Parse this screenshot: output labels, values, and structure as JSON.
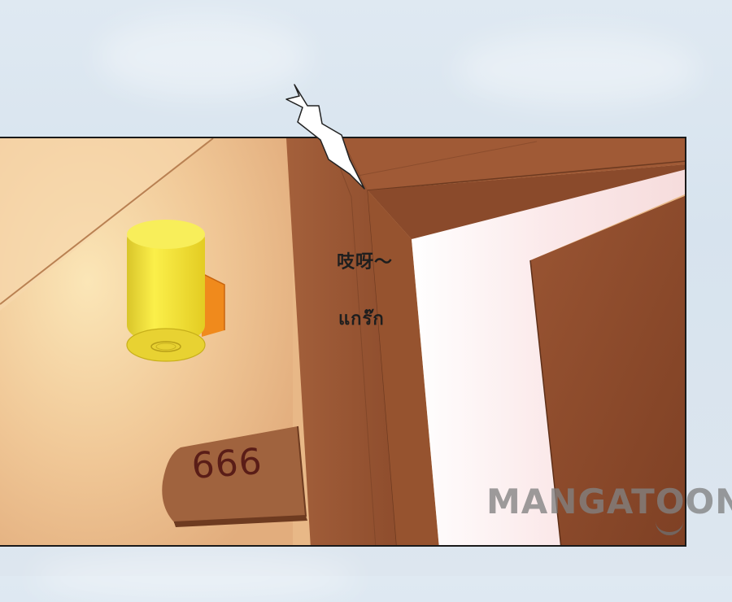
{
  "comic": {
    "sound_effect_chinese": "吱呀～",
    "sound_effect_thai": "แกร๊ก",
    "door_plaque_number": "666",
    "watermark_text": "MANGATOON"
  },
  "colors": {
    "wall": "#e8b887",
    "door_wood": "#9b5636",
    "lamp_yellow": "#f4e02a",
    "plaque_brown": "#a0633e",
    "plaque_text": "#5a1d17",
    "panel_border": "#1a1a1a"
  },
  "icons": {
    "watermark_logo": "smile-curve-icon"
  }
}
